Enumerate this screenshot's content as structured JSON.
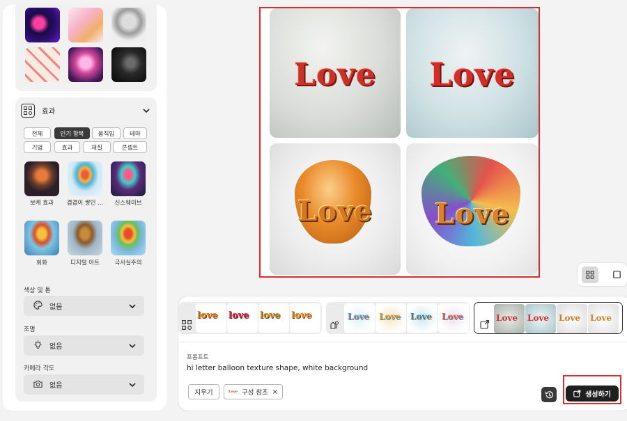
{
  "sidebar": {
    "effects": {
      "title": "효과",
      "chips_row1": [
        "전체",
        "인기 항목",
        "움직임",
        "테마"
      ],
      "chips_row2": [
        "기법",
        "효과",
        "재질",
        "콘셉트"
      ],
      "active_chip": "인기 항목",
      "tiles": [
        "보케 효과",
        "겹겹이 쌓인 ...",
        "신스웨이브",
        "회화",
        "디지털 아트",
        "극사실주의"
      ]
    },
    "color_tone": {
      "label": "색상 및 톤",
      "value": "없음"
    },
    "lighting": {
      "label": "조명",
      "value": "없음"
    },
    "camera_angle": {
      "label": "카메라 각도",
      "value": "없음"
    }
  },
  "results": {
    "images": [
      {
        "text": "Love"
      },
      {
        "text": "Love"
      },
      {
        "text": "Love"
      },
      {
        "text": "Love"
      }
    ]
  },
  "reference_strips": {
    "group1": [
      "love",
      "love",
      "love",
      "love"
    ],
    "group2": [
      "Love",
      "Love",
      "Love",
      "Love"
    ],
    "group3": [
      "Love",
      "Love",
      "Love",
      "Love"
    ]
  },
  "prompt": {
    "label": "프롬프트",
    "text": "hi letter balloon texture shape, white background",
    "clear_label": "지우기",
    "reference_chip": {
      "thumb_text": "Love",
      "label": "구성 참조",
      "close": "×"
    }
  },
  "generate_label": "생성하기",
  "colors": {
    "highlight": "#e22a2a",
    "accent_dark": "#1f1f1f"
  }
}
